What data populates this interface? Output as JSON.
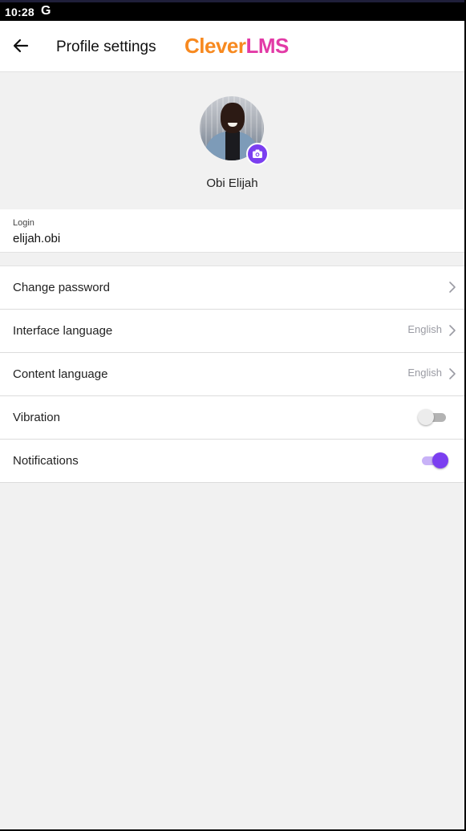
{
  "status_bar": {
    "time": "10:28",
    "g_icon": "G"
  },
  "header": {
    "title": "Profile settings",
    "brand_part1": "Clever",
    "brand_part2": "LMS",
    "brand_colors": {
      "clever": "#f7891f",
      "lms": "#e23aa6"
    }
  },
  "profile": {
    "name": "Obi Elijah",
    "camera_badge_color": "#7b3ff0"
  },
  "login": {
    "label": "Login",
    "value": "elijah.obi"
  },
  "settings": {
    "change_password": {
      "label": "Change password"
    },
    "interface_language": {
      "label": "Interface language",
      "value": "English"
    },
    "content_language": {
      "label": "Content language",
      "value": "English"
    },
    "vibration": {
      "label": "Vibration",
      "enabled": false
    },
    "notifications": {
      "label": "Notifications",
      "enabled": true
    }
  },
  "colors": {
    "accent": "#7b3ff0",
    "background": "#f1f1f1"
  }
}
